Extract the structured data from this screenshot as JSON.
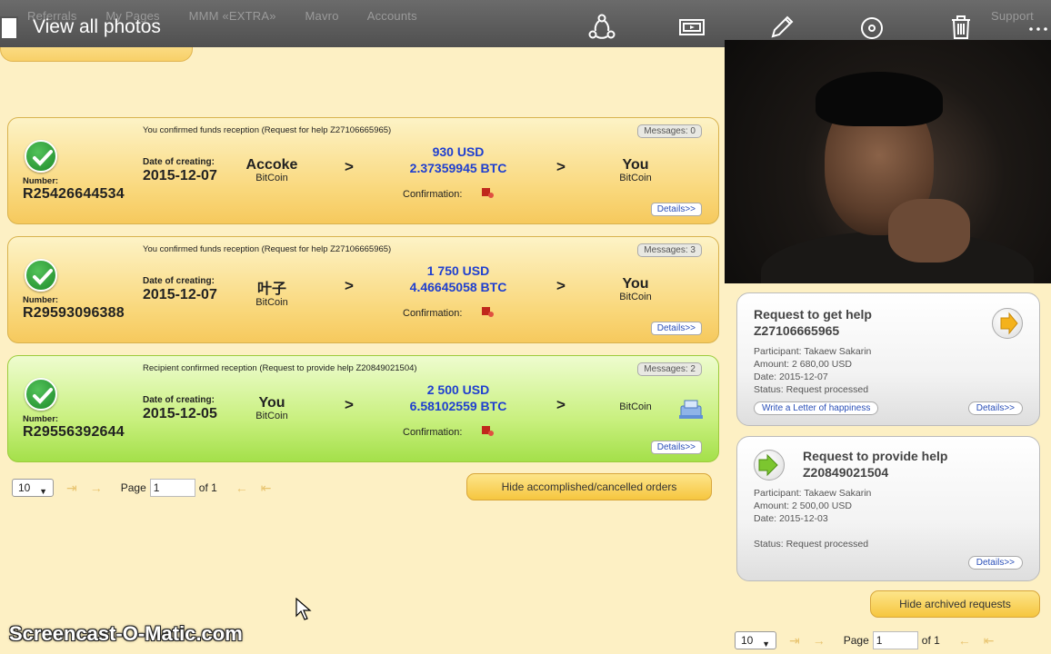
{
  "viewer": {
    "view_all_label": "View all photos",
    "background_nav": [
      "Referrals",
      "My Pages",
      "MMM «EXTRA»",
      "Mavro",
      "Accounts",
      "Support"
    ],
    "tools": [
      "share-icon",
      "slideshow-icon",
      "edit-icon",
      "rotate-icon",
      "delete-icon",
      "more-icon"
    ]
  },
  "orders": [
    {
      "header": "You confirmed funds reception (Request for help Z27106665965)",
      "messages": "Messages: 0",
      "number_label": "Number:",
      "number": "R25426644534",
      "date_label": "Date of creating:",
      "date": "2015-12-07",
      "from_name": "Accoke",
      "from_sub": "BitCoin",
      "usd": "930 USD",
      "btc": "2.37359945 BTC",
      "to_name": "You",
      "to_sub": "BitCoin",
      "arrow": ">",
      "confirmation_label": "Confirmation:",
      "details": "Details>>",
      "color": "#f9d77a"
    },
    {
      "header": "You confirmed funds reception (Request for help Z27106665965)",
      "messages": "Messages: 3",
      "number_label": "Number:",
      "number": "R29593096388",
      "date_label": "Date of creating:",
      "date": "2015-12-07",
      "from_name": "叶子",
      "from_sub": "BitCoin",
      "usd": "1 750 USD",
      "btc": "4.46645058 BTC",
      "to_name": "You",
      "to_sub": "BitCoin",
      "arrow": ">",
      "confirmation_label": "Confirmation:",
      "details": "Details>>",
      "color": "#f9d77a"
    },
    {
      "header": "Recipient confirmed reception (Request to provide help Z20849021504)",
      "messages": "Messages: 2",
      "number_label": "Number:",
      "number": "R29556392644",
      "date_label": "Date of creating:",
      "date": "2015-12-05",
      "from_name": "You",
      "from_sub": "BitCoin",
      "usd": "2 500 USD",
      "btc": "6.58102559 BTC",
      "to_name": "",
      "to_sub": "BitCoin",
      "arrow": ">",
      "confirmation_label": "Confirmation:",
      "details": "Details>>",
      "color": "#c9f07f"
    }
  ],
  "left_pager": {
    "per_page": "10",
    "page_label": "Page",
    "page_value": "1",
    "of_label": "of 1",
    "hide_button": "Hide accomplished/cancelled orders"
  },
  "requests": [
    {
      "title_line1": "Request to get help",
      "title_line2": "Z27106665965",
      "participant": "Participant: Takaew Sakarin",
      "amount": "Amount: 2 680,00 USD",
      "date": "Date: 2015-12-07",
      "status": "Status: Request processed",
      "letter_button": "Write a Letter of happiness",
      "details": "Details>>"
    },
    {
      "title_line1": "Request to provide help",
      "title_line2": "Z20849021504",
      "participant": "Participant: Takaew Sakarin",
      "amount": "Amount: 2 500,00 USD",
      "date": "Date: 2015-12-03",
      "status": "Status: Request processed",
      "details": "Details>>"
    }
  ],
  "right_pager": {
    "hide_button": "Hide archived requests",
    "per_page": "10",
    "page_label": "Page",
    "page_value": "1",
    "of_label": "of 1"
  },
  "watermark": "Screencast-O-Matic.com",
  "colors": {
    "background": "#fdf0c4",
    "accent_blue": "#1f3fcf",
    "check_green": "#1d8a2a",
    "orange_card": "#f9d77a",
    "green_card": "#c9f07f"
  }
}
